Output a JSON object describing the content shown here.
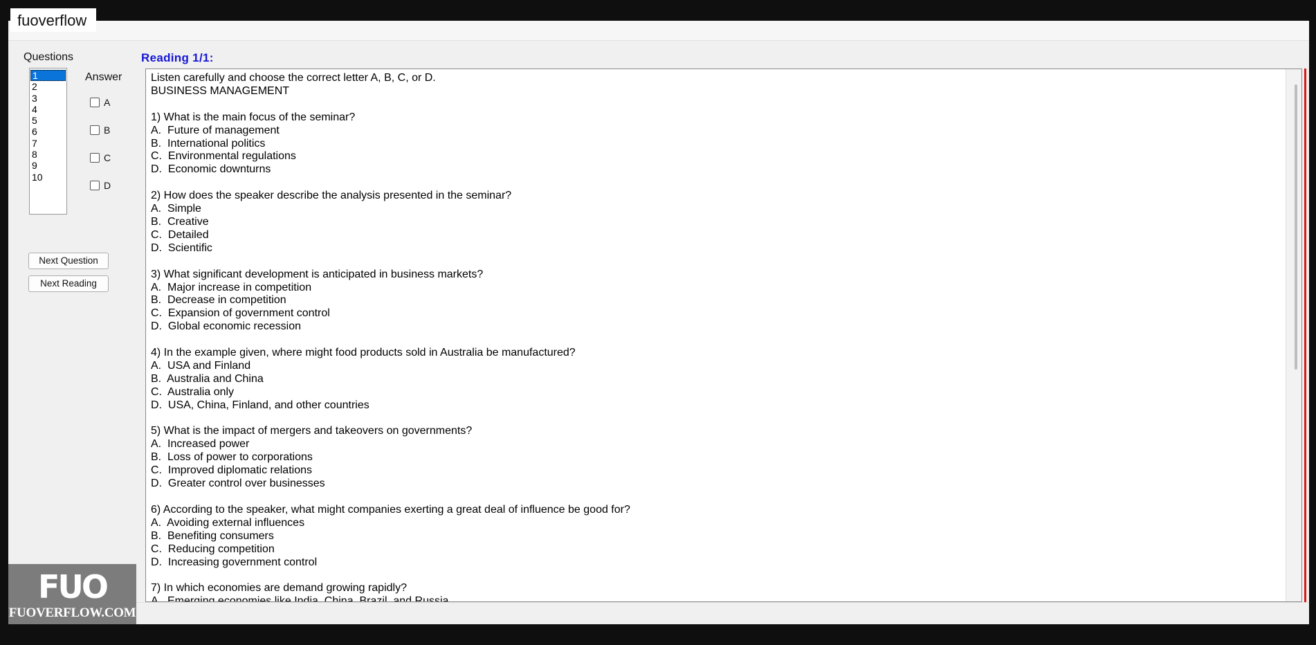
{
  "watermark_tag": "fuoverflow",
  "questions_label": "Questions",
  "reading_label": "Reading 1/1:",
  "question_numbers": [
    "1",
    "2",
    "3",
    "4",
    "5",
    "6",
    "7",
    "8",
    "9",
    "10"
  ],
  "answer_label": "Answer",
  "options": [
    "A",
    "B",
    "C",
    "D"
  ],
  "buttons": {
    "next_question": "Next Question",
    "next_reading": "Next Reading"
  },
  "reading_text": "Listen carefully and choose the correct letter A, B, C, or D.\nBUSINESS MANAGEMENT\n\n1) What is the main focus of the seminar?\nA.  Future of management\nB.  International politics\nC.  Environmental regulations\nD.  Economic downturns\n\n2) How does the speaker describe the analysis presented in the seminar?\nA.  Simple\nB.  Creative\nC.  Detailed\nD.  Scientific\n\n3) What significant development is anticipated in business markets?\nA.  Major increase in competition\nB.  Decrease in competition\nC.  Expansion of government control\nD.  Global economic recession\n\n4) In the example given, where might food products sold in Australia be manufactured?\nA.  USA and Finland\nB.  Australia and China\nC.  Australia only\nD.  USA, China, Finland, and other countries\n\n5) What is the impact of mergers and takeovers on governments?\nA.  Increased power\nB.  Loss of power to corporations\nC.  Improved diplomatic relations\nD.  Greater control over businesses\n\n6) According to the speaker, what might companies exerting a great deal of influence be good for?\nA.  Avoiding external influences\nB.  Benefiting consumers\nC.  Reducing competition\nD.  Increasing government control\n\n7) In which economies are demand growing rapidly?\nA.  Emerging economies like India, China, Brazil, and Russia",
  "logo": {
    "mark": "FUO",
    "text": "FUOVERFLOW.COM"
  },
  "colors": {
    "selection": "#0a74da",
    "reading_label": "#1515d6",
    "edge_bar": "#e01515"
  }
}
